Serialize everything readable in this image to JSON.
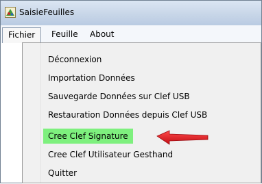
{
  "window": {
    "title": "SaisieFeuilles",
    "icon": "app-icon"
  },
  "menubar": {
    "items": [
      {
        "label": "Fichier",
        "state": "open"
      },
      {
        "label": "Feuille"
      },
      {
        "label": "About"
      }
    ]
  },
  "dropdown": {
    "items": [
      {
        "label": "Déconnexion"
      },
      {
        "label": "Importation Données"
      },
      {
        "label": "Sauvegarde Données sur Clef USB"
      },
      {
        "label": "Restauration Données depuis Clef USB"
      },
      {
        "label": "Cree Clef Signature",
        "highlighted": true
      },
      {
        "label": "Cree Clef Utilisateur Gesthand"
      },
      {
        "label": "Quitter"
      }
    ],
    "highlight_color": "#7ef07e"
  },
  "annotation": {
    "arrow_color": "#e0141b"
  }
}
